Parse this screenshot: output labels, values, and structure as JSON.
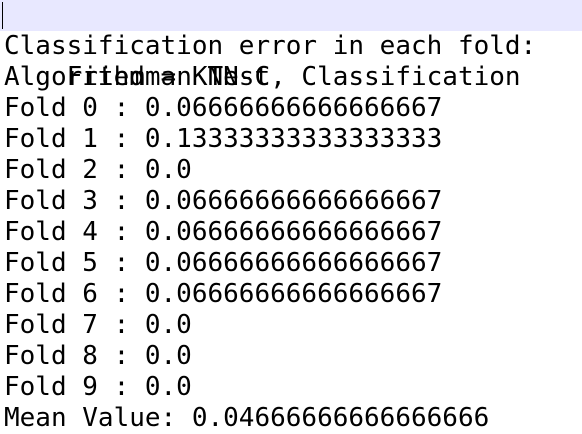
{
  "lines": [
    "Friedman Test, Classification",
    "Classification error in each fold:",
    "Algorithm = KNN-C",
    "Fold 0 : 0.06666666666666667",
    "Fold 1 : 0.13333333333333333",
    "Fold 2 : 0.0",
    "Fold 3 : 0.06666666666666667",
    "Fold 4 : 0.06666666666666667",
    "Fold 5 : 0.06666666666666667",
    "Fold 6 : 0.06666666666666667",
    "Fold 7 : 0.0",
    "Fold 8 : 0.0",
    "Fold 9 : 0.0",
    "Mean Value: 0.04666666666666666"
  ],
  "colors": {
    "current_line_highlight": "#e8e8ff",
    "text": "#000000",
    "background": "#ffffff"
  }
}
